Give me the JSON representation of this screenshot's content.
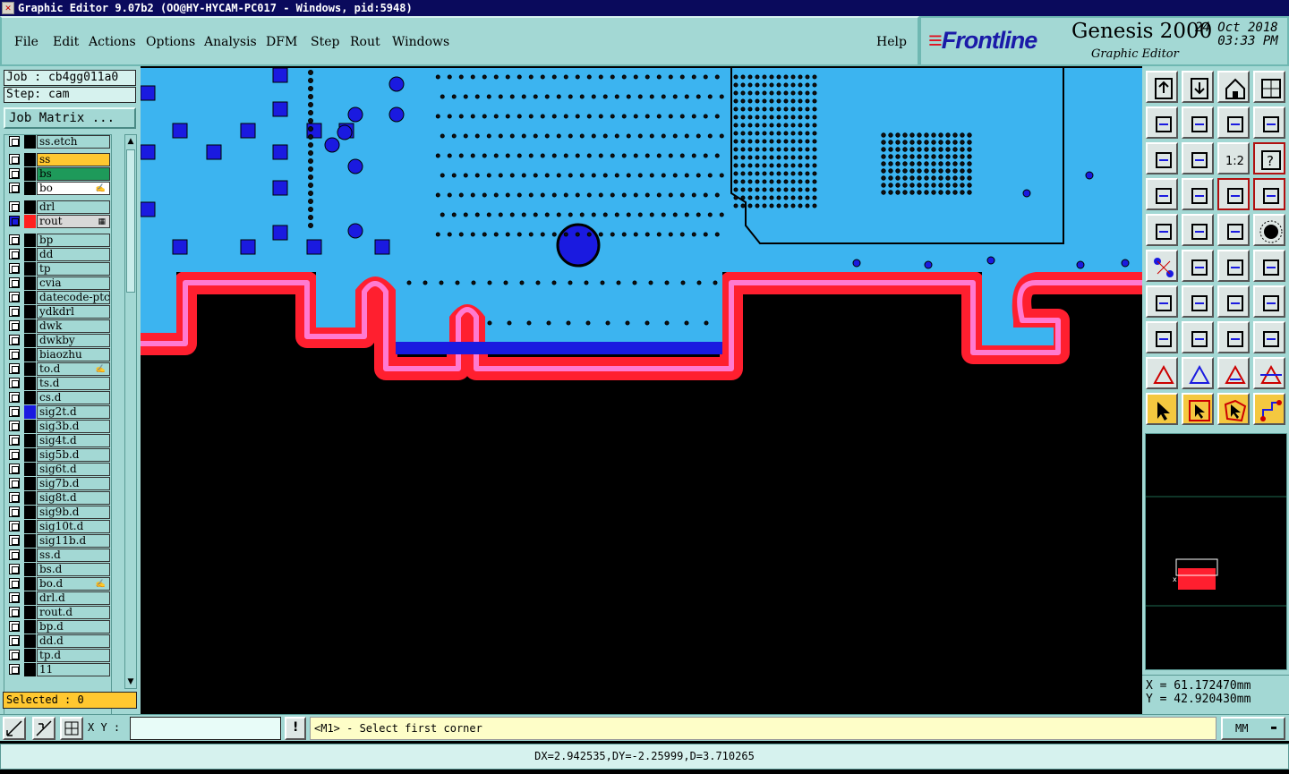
{
  "window": {
    "title": "Graphic Editor 9.07b2 (OO@HY-HYCAM-PC017 - Windows, pid:5948)"
  },
  "menu": {
    "file": "File",
    "edit": "Edit",
    "actions": "Actions",
    "options": "Options",
    "analysis": "Analysis",
    "dfm": "DFM",
    "step": "Step",
    "rout": "Rout",
    "windows": "Windows",
    "help": "Help"
  },
  "brand": {
    "logo": "Frontline",
    "product": "Genesis 2000",
    "subtitle": "Graphic Editor",
    "date": "24 Oct 2018",
    "time": "03:33 PM"
  },
  "job": {
    "job_text": "Job : cb4gg011a0",
    "step_text": "Step: cam",
    "matrix_label": "Job Matrix ..."
  },
  "layers": [
    {
      "name": "ss.etch",
      "swatch": "#000000"
    },
    {
      "name": "ss",
      "swatch": "#000000",
      "bg": "#ffc830"
    },
    {
      "name": "bs",
      "swatch": "#000000",
      "bg": "#1e9a5a"
    },
    {
      "name": "bo",
      "swatch": "#000000",
      "bg": "#ffffff",
      "mark": "✍"
    },
    {
      "name": "drl",
      "swatch": "#000000"
    },
    {
      "name": "rout",
      "swatch": "#ff2020",
      "mark": "▦",
      "active": true
    },
    {
      "name": "bp",
      "swatch": "#000000"
    },
    {
      "name": "dd",
      "swatch": "#000000"
    },
    {
      "name": "tp",
      "swatch": "#000000"
    },
    {
      "name": "cvia",
      "swatch": "#000000"
    },
    {
      "name": "datecode-ptc",
      "swatch": "#000000"
    },
    {
      "name": "ydkdrl",
      "swatch": "#000000"
    },
    {
      "name": "dwk",
      "swatch": "#000000"
    },
    {
      "name": "dwkby",
      "swatch": "#000000"
    },
    {
      "name": "biaozhu",
      "swatch": "#000000"
    },
    {
      "name": "to.d",
      "swatch": "#000000",
      "mark": "✍"
    },
    {
      "name": "ts.d",
      "swatch": "#000000"
    },
    {
      "name": "cs.d",
      "swatch": "#000000"
    },
    {
      "name": "sig2t.d",
      "swatch": "#1a1ae0"
    },
    {
      "name": "sig3b.d",
      "swatch": "#000000"
    },
    {
      "name": "sig4t.d",
      "swatch": "#000000"
    },
    {
      "name": "sig5b.d",
      "swatch": "#000000"
    },
    {
      "name": "sig6t.d",
      "swatch": "#000000"
    },
    {
      "name": "sig7b.d",
      "swatch": "#000000"
    },
    {
      "name": "sig8t.d",
      "swatch": "#000000"
    },
    {
      "name": "sig9b.d",
      "swatch": "#000000"
    },
    {
      "name": "sig10t.d",
      "swatch": "#000000"
    },
    {
      "name": "sig11b.d",
      "swatch": "#000000"
    },
    {
      "name": "ss.d",
      "swatch": "#000000"
    },
    {
      "name": "bs.d",
      "swatch": "#000000"
    },
    {
      "name": "bo.d",
      "swatch": "#000000",
      "mark": "✍"
    },
    {
      "name": "drl.d",
      "swatch": "#000000"
    },
    {
      "name": "rout.d",
      "swatch": "#000000"
    },
    {
      "name": "bp.d",
      "swatch": "#000000"
    },
    {
      "name": "dd.d",
      "swatch": "#000000"
    },
    {
      "name": "tp.d",
      "swatch": "#000000"
    },
    {
      "name": "11",
      "swatch": "#000000"
    }
  ],
  "selection": {
    "text": "Selected : 0"
  },
  "coords": {
    "x_text": "X  =  61.172470mm",
    "y_text": "Y  =  42.920430mm"
  },
  "bottom": {
    "xy_label": "X Y :",
    "xy_value": "",
    "prompt": "<M1> - Select first corner",
    "units": "MM"
  },
  "status": {
    "measure": "DX=2.942535,DY=-2.25999,D=3.710265"
  },
  "colors": {
    "board": "#3cb4f0",
    "rout": "#ff1f2f",
    "pad": "#1a1ae0",
    "panel": "#a3d8d4"
  },
  "toolbar": [
    "page-up-icon",
    "page-down-icon",
    "home-icon",
    "window-icon",
    "pan-left-icon",
    "pan-right-icon",
    "flip-icon",
    "mirror-icon",
    "zoom-fit-icon",
    "zoom-center-icon",
    "scale-1-2-icon",
    "help-icon",
    "measure-tool-icon",
    "grid-icon",
    "layer-red-icon",
    "layer-red-2-icon",
    "snapshot-icon",
    "draw-icon",
    "ruler-icon",
    "circle-icon",
    "node-icon",
    "cross-icon",
    "arc-icon",
    "arc-2-icon",
    "angle-icon",
    "line-icon",
    "rotate-icon",
    "text-f-icon",
    "pad-icon",
    "minus-icon",
    "dimension-icon",
    "component-icon",
    "triangle-icon",
    "triangle-2-icon",
    "triangle-3-icon",
    "triangle-4-icon",
    "select-icon",
    "select-box-icon",
    "select-poly-icon",
    "route-icon"
  ]
}
